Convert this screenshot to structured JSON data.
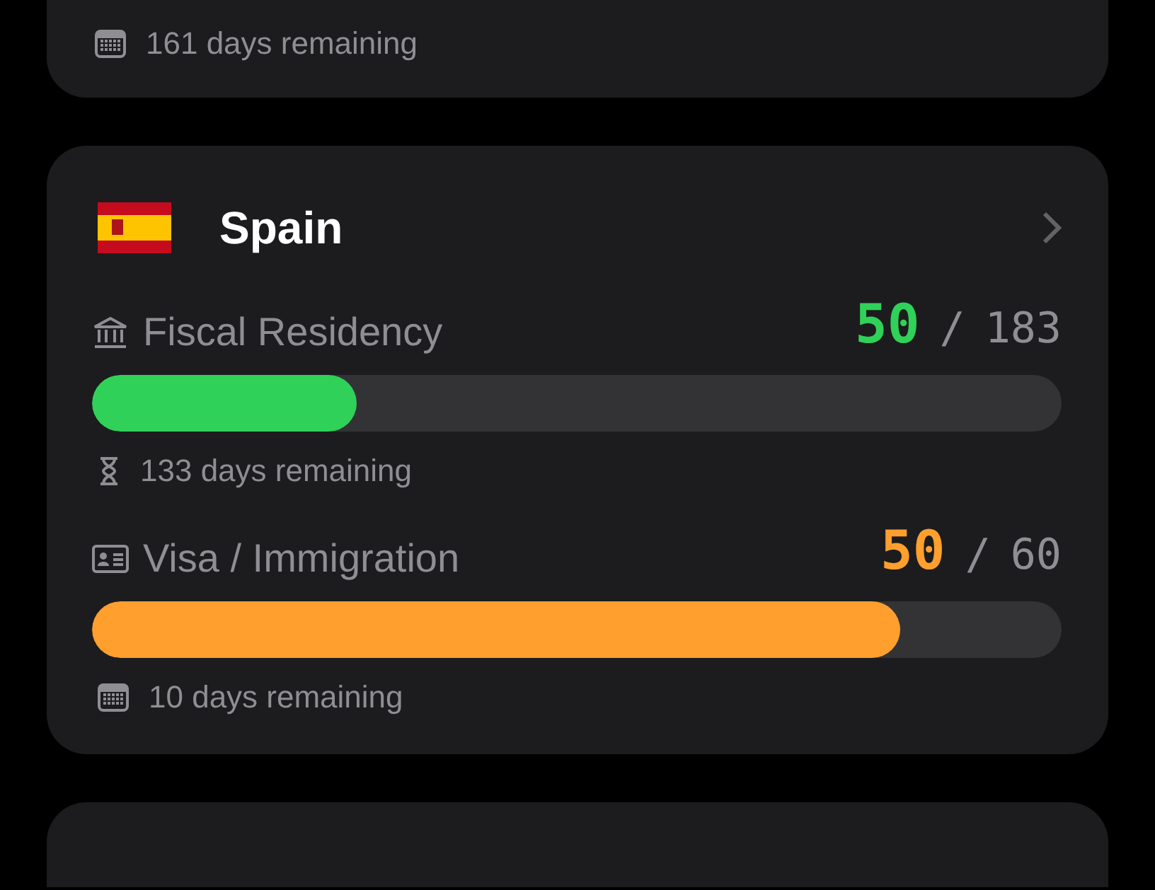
{
  "previous_card": {
    "remaining": "161 days remaining"
  },
  "card": {
    "country": "Spain",
    "trackers": [
      {
        "kind": "fiscal",
        "label": "Fiscal Residency",
        "count": "50",
        "separator": "/",
        "limit": "183",
        "color": "#30d158",
        "level": 0.273,
        "remaining": "133 days remaining"
      },
      {
        "kind": "visa",
        "label": "Visa / Immigration",
        "count": "50",
        "separator": "/",
        "limit": "60",
        "color": "#ff9f2e",
        "level": 0.833,
        "remaining": "10 days remaining"
      }
    ]
  }
}
